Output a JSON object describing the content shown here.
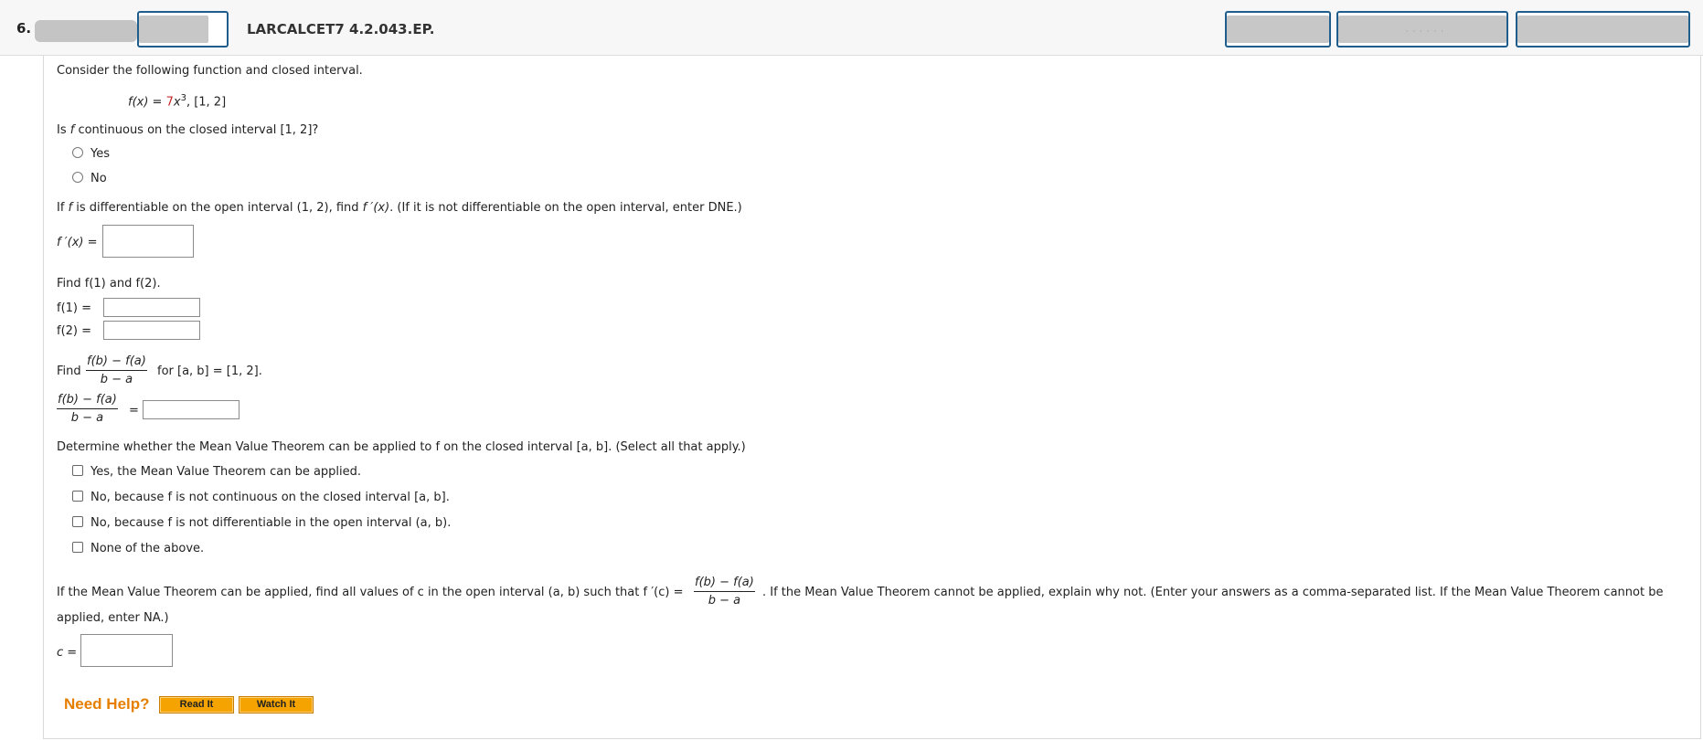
{
  "header": {
    "question_number": "6.",
    "title": "LARCALCET7 4.2.043.EP."
  },
  "intro": "Consider the following function and closed interval.",
  "function_def": {
    "lhs": "f(x) = ",
    "coef": "7",
    "var": "x",
    "exp": "3",
    "interval": ",    [1, 2]"
  },
  "q1": {
    "prompt_a": "Is ",
    "prompt_f": "f",
    "prompt_b": " continuous on the closed interval [1, 2]?",
    "options": [
      "Yes",
      "No"
    ]
  },
  "q2": {
    "prompt_a": "If ",
    "prompt_f": "f",
    "prompt_b": " is differentiable on the open interval (1, 2), find ",
    "prompt_fp": "f ′(x)",
    "prompt_c": ". (If it is not differentiable on the open interval, enter DNE.)",
    "label": "f ′(x) ="
  },
  "q3": {
    "prompt": "Find f(1) and f(2).",
    "label1": "f(1)  =",
    "label2": "f(2)  ="
  },
  "q4": {
    "find": "Find",
    "frac_num": "f(b) − f(a)",
    "frac_den": "b − a",
    "tail": "for [a, b] = [1, 2].",
    "eq": "="
  },
  "q5": {
    "prompt": "Determine whether the Mean Value Theorem can be applied to f on the closed interval [a, b]. (Select all that apply.)",
    "options": [
      "Yes, the Mean Value Theorem can be applied.",
      "No, because f is not continuous on the closed interval [a, b].",
      "No, because f is not differentiable in the open interval (a, b).",
      "None of the above."
    ]
  },
  "q6": {
    "prompt_a": "If the Mean Value Theorem can be applied, find all values of c in the open interval (a, b) such that f ′(c) =",
    "frac_num": "f(b) − f(a)",
    "frac_den": "b − a",
    "prompt_b": ". If the Mean Value Theorem cannot be applied, explain why not. (Enter your answers as a comma-separated list. If the Mean Value Theorem cannot be",
    "prompt_c": "applied, enter NA.)",
    "label": "c ="
  },
  "help": {
    "label": "Need Help?",
    "read": "Read It",
    "watch": "Watch It"
  }
}
